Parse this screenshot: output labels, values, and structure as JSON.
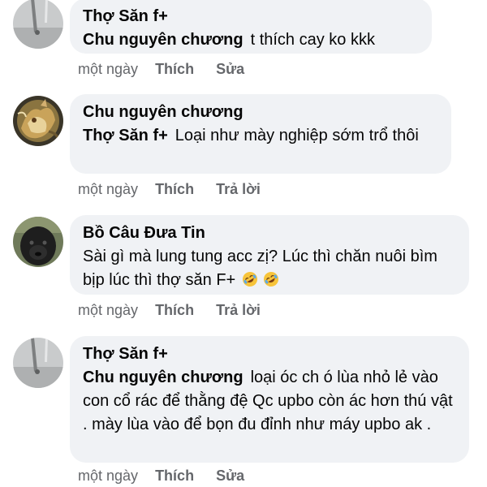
{
  "comments": [
    {
      "author": "Thợ Săn f+",
      "mention": "Chu nguyên chương",
      "text": "t thích cay ko kkk",
      "time": "một ngày",
      "like": "Thích",
      "action": "Sửa",
      "avatar_icon": "gray-photo-avatar-icon"
    },
    {
      "author": "Chu nguyên chương",
      "mention": "Thợ Săn f+",
      "text": "Loại như mày nghiệp sớm trổ thôi",
      "time": "một ngày",
      "like": "Thích",
      "action": "Trả lời",
      "avatar_icon": "dragon-artwork-avatar-icon"
    },
    {
      "author": "Bồ Câu Đưa Tin",
      "mention": "",
      "text": "Sài gì mà lung tung acc zị? Lúc thì chăn nuôi bìm bịp lúc thì thợ săn F+",
      "time": "một ngày",
      "like": "Thích",
      "action": "Trả lời",
      "avatar_icon": "dark-animal-avatar-icon",
      "emoji_icon": "rolling-on-floor-laughing-emoji"
    },
    {
      "author": "Thợ Săn f+",
      "mention": "Chu nguyên chương",
      "text": "loại óc ch ó lùa nhỏ lẻ vào con cổ rác để thằng đệ Qc upbo còn ác hơn thú vật . mày lùa vào để bọn đu đỉnh như máy upbo ak .",
      "time": "một ngày",
      "like": "Thích",
      "action": "Sửa",
      "avatar_icon": "gray-photo-avatar-icon"
    }
  ],
  "colors": {
    "bubble": "#f0f2f5",
    "text": "#050505",
    "meta": "#65676b"
  }
}
